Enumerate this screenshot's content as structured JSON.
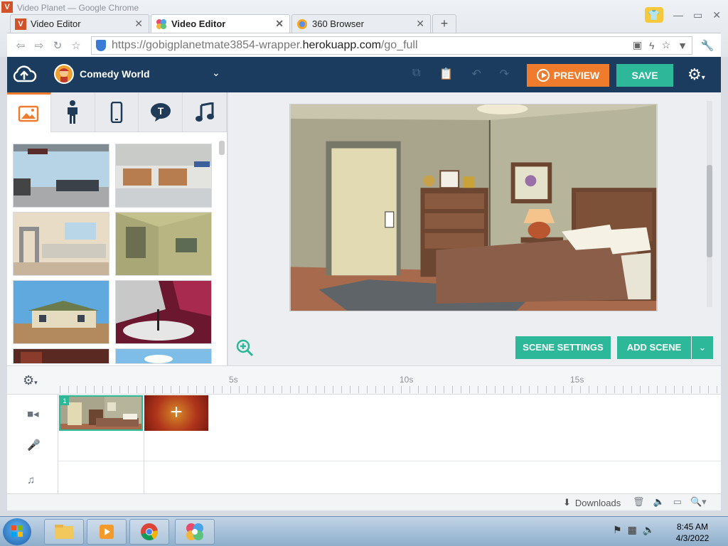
{
  "window": {
    "faded_title": "Video Planet — Google Chrome",
    "app_badge": "V"
  },
  "tabs": [
    {
      "label": "Video Editor",
      "active": false
    },
    {
      "label": "Video Editor",
      "active": true
    },
    {
      "label": "360 Browser",
      "active": false
    }
  ],
  "address": {
    "url_prefix": "https://gobigplanetmate3854-wrapper.",
    "url_domain": "herokuapp.com",
    "url_path": "/go_full"
  },
  "header": {
    "theme_name": "Comedy World",
    "preview_label": "PREVIEW",
    "save_label": "SAVE"
  },
  "asset_tabs": [
    "backgrounds",
    "characters",
    "props",
    "text",
    "music"
  ],
  "stage_buttons": {
    "scene_settings": "SCENE SETTINGS",
    "add_scene": "ADD SCENE"
  },
  "timeline": {
    "tick_labels": [
      "5s",
      "10s",
      "15s"
    ],
    "scene_number": "1",
    "add_symbol": "+"
  },
  "statusbar": {
    "downloads": "Downloads"
  },
  "taskbar": {
    "time": "8:45 AM",
    "date": "4/3/2022"
  },
  "colors": {
    "accent_teal": "#2eb89a",
    "accent_orange": "#ef7c2d",
    "header_navy": "#1b3c5e"
  }
}
